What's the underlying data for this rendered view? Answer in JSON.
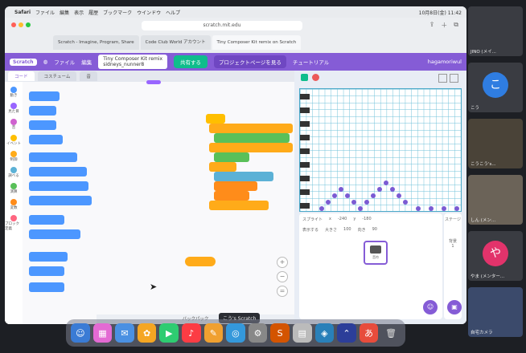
{
  "menubar": {
    "apple": "",
    "app": "Safari",
    "items": [
      "ファイル",
      "編集",
      "表示",
      "履歴",
      "ブックマーク",
      "ウインドウ",
      "ヘルプ"
    ],
    "clock": "10月8日(金) 11:42"
  },
  "browser": {
    "url": "scratch.mit.edu",
    "tabs": [
      "Scratch - Imagine, Program, Share",
      "Code Club World アカウント",
      "Tiny Composer Kit remix on Scratch"
    ]
  },
  "scratch": {
    "file_menu": "ファイル",
    "edit_menu": "編集",
    "project_title": "Tiny Composer Kit remix",
    "project_author": "sidneys_nunner8",
    "share_button": "共有する",
    "project_page_button": "プロジェクトページを見る",
    "tutorial_label": "チュートリアル",
    "username": "hagamoriwul",
    "code_tab": "コード",
    "costume_tab": "コスチューム",
    "sound_tab": "音",
    "categories": [
      "動き",
      "見た目",
      "音",
      "イベント",
      "制御",
      "調べる",
      "演算",
      "変数",
      "ブロック定義"
    ],
    "backpack_label": "バックパック",
    "sprite_label": "スプライト",
    "stage_label": "ステージ",
    "x_label": "x",
    "y_label": "y",
    "x_value": "-240",
    "y_value": "-180",
    "show_label": "表示する",
    "size_label": "大きさ",
    "size_value": "100",
    "direction_label": "向き",
    "direction_value": "90",
    "backdrop_label": "背景",
    "backdrop_count": "1",
    "sprite_name": "音符"
  },
  "dock": {
    "tooltip": "こう's Scratch"
  },
  "meeting": {
    "participants": [
      {
        "name": "JINO (メイ...",
        "initial": ""
      },
      {
        "name": "こう",
        "initial": "こ"
      },
      {
        "name": "こうこう's...",
        "initial": ""
      },
      {
        "name": "しん (メン...",
        "initial": ""
      },
      {
        "name": "やま (メンター...",
        "initial": "や"
      },
      {
        "name": "自宅カメラ",
        "initial": ""
      }
    ]
  },
  "colors": {
    "scratch_purple": "#855cd6",
    "motion": "#4c97ff",
    "looks": "#9966ff",
    "sound": "#cf63cf",
    "events": "#ffbf00",
    "control": "#ffab19",
    "sensing": "#5cb1d6",
    "operators": "#59c059",
    "variables": "#ff8c1a",
    "myblocks": "#ff6680"
  }
}
